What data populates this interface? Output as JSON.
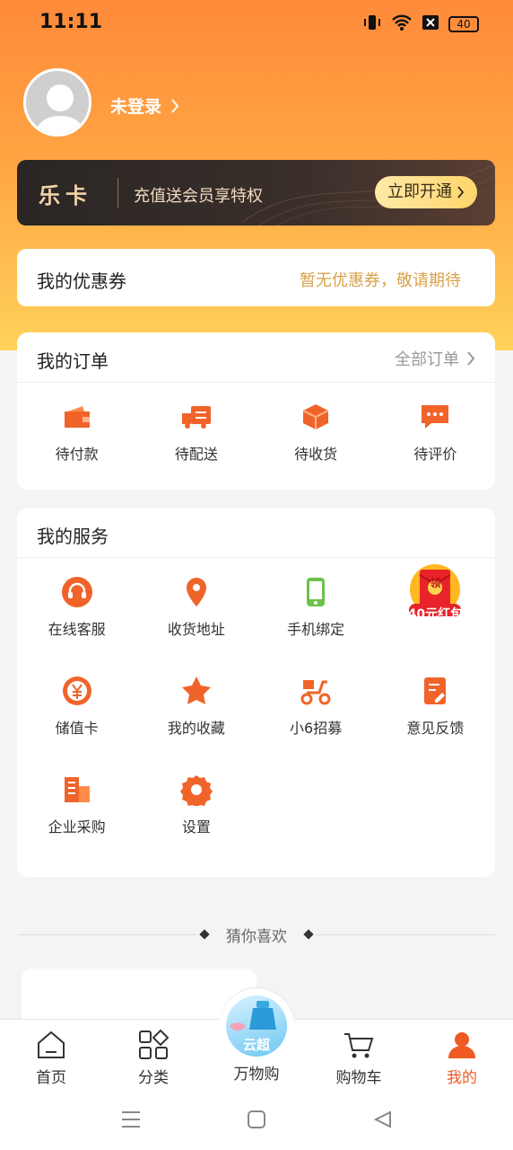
{
  "status": {
    "time": "11:11",
    "battery": "40"
  },
  "user": {
    "login_label": "未登录"
  },
  "vip_card": {
    "logo": "乐卡",
    "desc": "充值送会员享特权",
    "button": "立即开通"
  },
  "coupon": {
    "title": "我的优惠券",
    "hint": "暂无优惠券，敬请期待"
  },
  "orders": {
    "title": "我的订单",
    "more": "全部订单",
    "items": [
      {
        "label": "待付款",
        "icon": "wallet-icon"
      },
      {
        "label": "待配送",
        "icon": "truck-icon"
      },
      {
        "label": "待收货",
        "icon": "package-icon"
      },
      {
        "label": "待评价",
        "icon": "comment-icon"
      }
    ]
  },
  "services": {
    "title": "我的服务",
    "items": [
      {
        "label": "在线客服",
        "icon": "headset-icon"
      },
      {
        "label": "收货地址",
        "icon": "location-icon"
      },
      {
        "label": "手机绑定",
        "icon": "phone-icon"
      },
      {
        "label": "40元红包",
        "icon": "red-envelope-icon"
      },
      {
        "label": "储值卡",
        "icon": "yen-coin-icon"
      },
      {
        "label": "我的收藏",
        "icon": "star-icon"
      },
      {
        "label": "小6招募",
        "icon": "scooter-icon"
      },
      {
        "label": "意见反馈",
        "icon": "feedback-icon"
      },
      {
        "label": "企业采购",
        "icon": "building-icon"
      },
      {
        "label": "设置",
        "icon": "gear-icon"
      }
    ],
    "red_envelope_badge": "领"
  },
  "recommend": {
    "title": "猜你喜欢"
  },
  "tabbar": {
    "items": [
      {
        "label": "首页",
        "icon": "home-icon"
      },
      {
        "label": "分类",
        "icon": "category-icon"
      },
      {
        "label": "万物购",
        "icon": "cloud-mall-icon",
        "badge": "云超"
      },
      {
        "label": "购物车",
        "icon": "cart-icon"
      },
      {
        "label": "我的",
        "icon": "user-icon",
        "active": true
      }
    ]
  },
  "colors": {
    "accent": "#ef5a22",
    "icon_orange": "#f0642a",
    "gold": "#d9a24d",
    "green": "#6cc24a"
  }
}
